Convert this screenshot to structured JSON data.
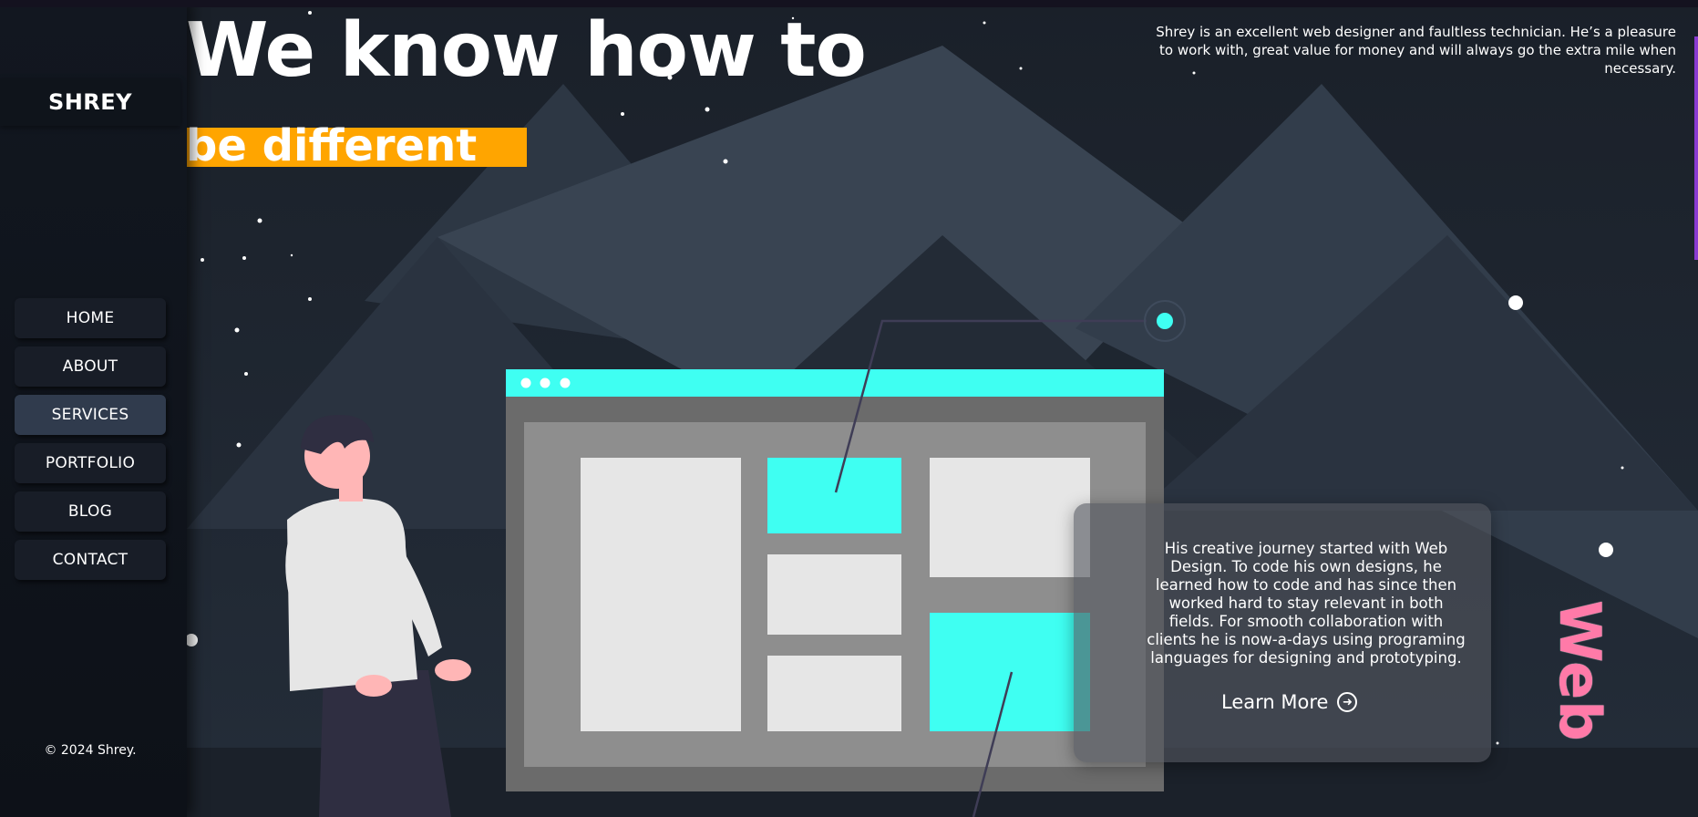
{
  "brand": {
    "logo": "SHREY"
  },
  "nav": {
    "items": [
      {
        "label": "HOME",
        "active": false
      },
      {
        "label": "ABOUT",
        "active": false
      },
      {
        "label": "SERVICES",
        "active": true
      },
      {
        "label": "PORTFOLIO",
        "active": false
      },
      {
        "label": "BLOG",
        "active": false
      },
      {
        "label": "CONTACT",
        "active": false
      }
    ]
  },
  "footer": {
    "copyright": "© 2024 Shrey."
  },
  "hero": {
    "title": "We know how to",
    "subtitle": "be different",
    "highlight_color": "#ffa500"
  },
  "testimonial": {
    "text": "Shrey is an excellent web designer and faultless technician. He’s a pleasure to work with, great value for money and will always go the extra mile when necessary."
  },
  "card": {
    "body": "His creative journey started with Web Design. To code his own designs, he learned how to code and has since then worked hard to stay relevant in both fields. For smooth collaboration with clients he is now-a-days using programing languages for designing and prototyping.",
    "cta": "Learn More",
    "cta_icon": "arrow-right-circle-icon"
  },
  "vertical_word": "Web",
  "colors": {
    "accent_cyan": "#3ffff2",
    "accent_orange": "#ffa500",
    "accent_pink": "#ff7aa8",
    "sidebar_bg": "#0f141b",
    "nav_active": "#303b4d"
  }
}
